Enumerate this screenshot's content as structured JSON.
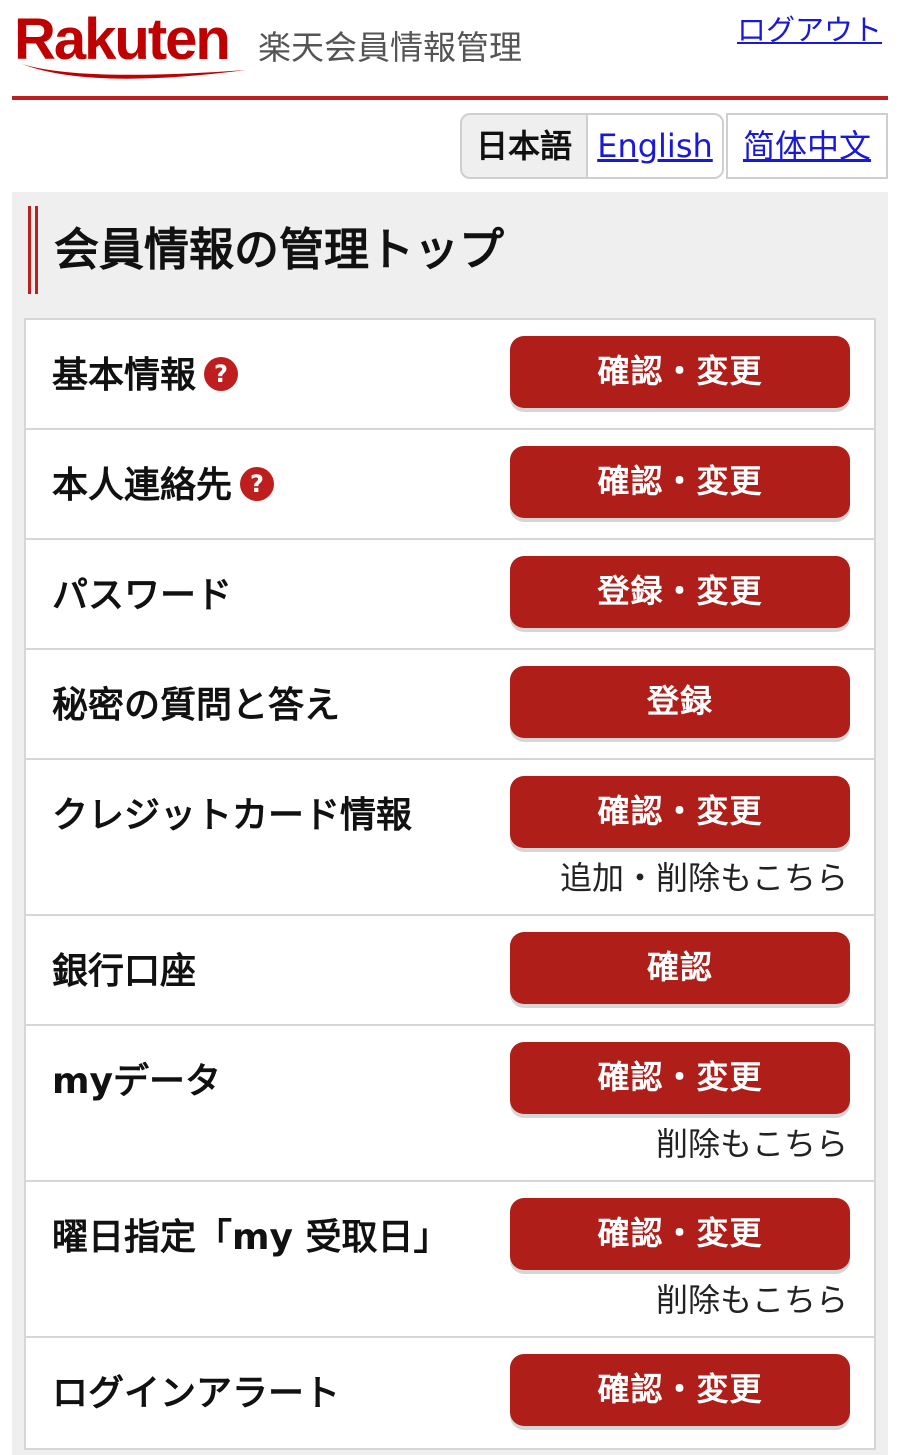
{
  "header": {
    "logo": "Rakuten",
    "title": "楽天会員情報管理",
    "logout": "ログアウト"
  },
  "languages": {
    "ja": "日本語",
    "en": "English",
    "zh": "简体中文"
  },
  "section": {
    "title": "会員情報の管理トップ"
  },
  "rows": [
    {
      "label": "基本情報",
      "button": "確認・変更",
      "help": "?"
    },
    {
      "label": "本人連絡先",
      "button": "確認・変更",
      "help": "?"
    },
    {
      "label": "パスワード",
      "button": "登録・変更"
    },
    {
      "label": "秘密の質問と答え",
      "button": "登録"
    },
    {
      "label": "クレジットカード情報",
      "button": "確認・変更",
      "note": "追加・削除もこちら"
    },
    {
      "label": "銀行口座",
      "button": "確認"
    },
    {
      "label": "myデータ",
      "button": "確認・変更",
      "note": "削除もこちら"
    },
    {
      "label": "曜日指定「my 受取日」",
      "button": "確認・変更",
      "note": "削除もこちら"
    },
    {
      "label": "ログインアラート",
      "button": "確認・変更"
    }
  ],
  "colors": {
    "brand": "#bf0000",
    "button": "#b01e1a",
    "link": "#1a1ad6"
  }
}
